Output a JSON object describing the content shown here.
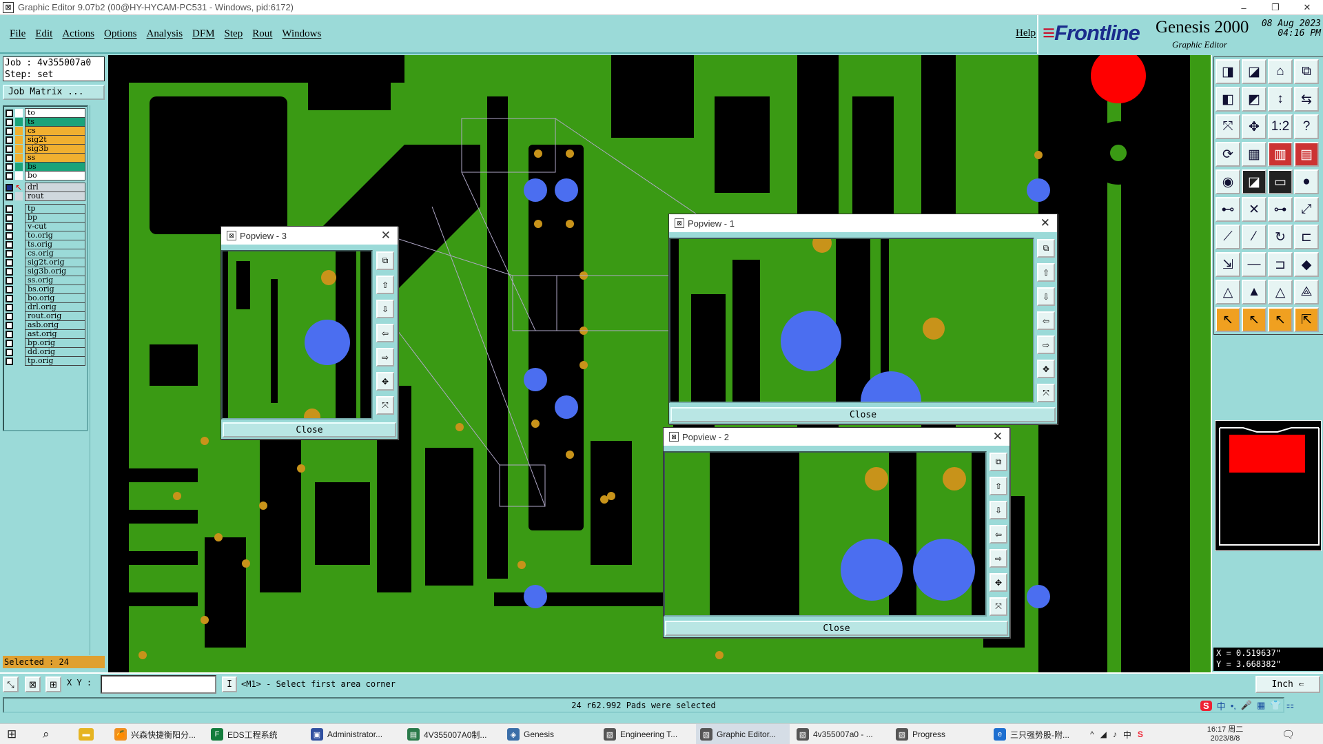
{
  "window": {
    "title": "Graphic Editor 9.07b2 (00@HY-HYCAM-PC531 - Windows, pid:6172)",
    "minimize": "–",
    "maximize": "❐",
    "close": "✕"
  },
  "menu": {
    "items": [
      "File",
      "Edit",
      "Actions",
      "Options",
      "Analysis",
      "DFM",
      "Step",
      "Rout",
      "Windows"
    ],
    "help": "Help"
  },
  "brand": {
    "logo": "Frontline",
    "product": "Genesis 2000",
    "subtitle": "Graphic Editor",
    "date_line1": "08 Aug 2023",
    "date_line2": "04:16 PM"
  },
  "job": {
    "job_line": "Job : 4v355007a0",
    "step_line": "Step: set",
    "matrix_button": "Job Matrix ..."
  },
  "layers": [
    {
      "name": "to",
      "color": "#ffffff"
    },
    {
      "name": "ts",
      "color": "#1aa37a"
    },
    {
      "name": "cs",
      "color": "#f0b030"
    },
    {
      "name": "sig2t",
      "color": "#f0b030"
    },
    {
      "name": "sig3b",
      "color": "#f0b030"
    },
    {
      "name": "ss",
      "color": "#f0b030"
    },
    {
      "name": "bs",
      "color": "#1aa37a"
    },
    {
      "name": "bo",
      "color": "#ffffff"
    },
    {
      "name": "drl",
      "color": "#cfd8dd"
    },
    {
      "name": "rout",
      "color": "#cfd8dd"
    },
    {
      "name": "tp",
      "color": "#9bdad8"
    },
    {
      "name": "bp",
      "color": "#9bdad8"
    },
    {
      "name": "v-cut",
      "color": "#9bdad8"
    },
    {
      "name": "to.orig",
      "color": "#9bdad8"
    },
    {
      "name": "ts.orig",
      "color": "#9bdad8"
    },
    {
      "name": "cs.orig",
      "color": "#9bdad8"
    },
    {
      "name": "sig2t.orig",
      "color": "#9bdad8"
    },
    {
      "name": "sig3b.orig",
      "color": "#9bdad8"
    },
    {
      "name": "ss.orig",
      "color": "#9bdad8"
    },
    {
      "name": "bs.orig",
      "color": "#9bdad8"
    },
    {
      "name": "bo.orig",
      "color": "#9bdad8"
    },
    {
      "name": "drl.orig",
      "color": "#9bdad8"
    },
    {
      "name": "rout.orig",
      "color": "#9bdad8"
    },
    {
      "name": "asb.orig",
      "color": "#9bdad8"
    },
    {
      "name": "ast.orig",
      "color": "#9bdad8"
    },
    {
      "name": "bp.orig",
      "color": "#9bdad8"
    },
    {
      "name": "dd.orig",
      "color": "#9bdad8"
    },
    {
      "name": "tp.orig",
      "color": "#9bdad8"
    }
  ],
  "selected": "Selected : 24",
  "popviews": [
    {
      "title": "Popview - 3",
      "close": "Close"
    },
    {
      "title": "Popview - 1",
      "close": "Close"
    },
    {
      "title": "Popview - 2",
      "close": "Close"
    }
  ],
  "coords": {
    "x": "X = 0.519637\"",
    "y": "Y = 3.668382\""
  },
  "bottom": {
    "xy_label": "X Y :",
    "xy_value": "",
    "pause": "I",
    "prompt": "<M1> - Select first area corner",
    "unit": "Inch ⇐",
    "status": "24 r62.992 Pads were selected"
  },
  "ime": {
    "s": "S",
    "zh": "中",
    "items": [
      "•,",
      "🎤",
      "▦",
      "👕",
      "⚏"
    ]
  },
  "taskbar": {
    "items": [
      {
        "label": "兴森快捷衡阳分...",
        "icon": "🍊"
      },
      {
        "label": "EDS工程系统",
        "icon": "F"
      },
      {
        "label": "Administrator...",
        "icon": "▣"
      },
      {
        "label": "4V355007A0制...",
        "icon": "▤"
      },
      {
        "label": "Genesis",
        "icon": "◈"
      },
      {
        "label": "Engineering T...",
        "icon": "▧"
      },
      {
        "label": "Graphic Editor...",
        "icon": "▧"
      },
      {
        "label": "4v355007a0 - ...",
        "icon": "▧"
      },
      {
        "label": "Progress",
        "icon": "▧"
      },
      {
        "label": "三只强势股-附...",
        "icon": "e"
      }
    ],
    "tray": [
      "^",
      "◢",
      "♪",
      "中",
      "S"
    ],
    "time": "16:17 周二",
    "date": "2023/8/8"
  },
  "colors": {
    "board": "#3a9a14",
    "pad": "#c8931a",
    "drill": "#4b6ef0",
    "accent": "#9bdad8"
  }
}
